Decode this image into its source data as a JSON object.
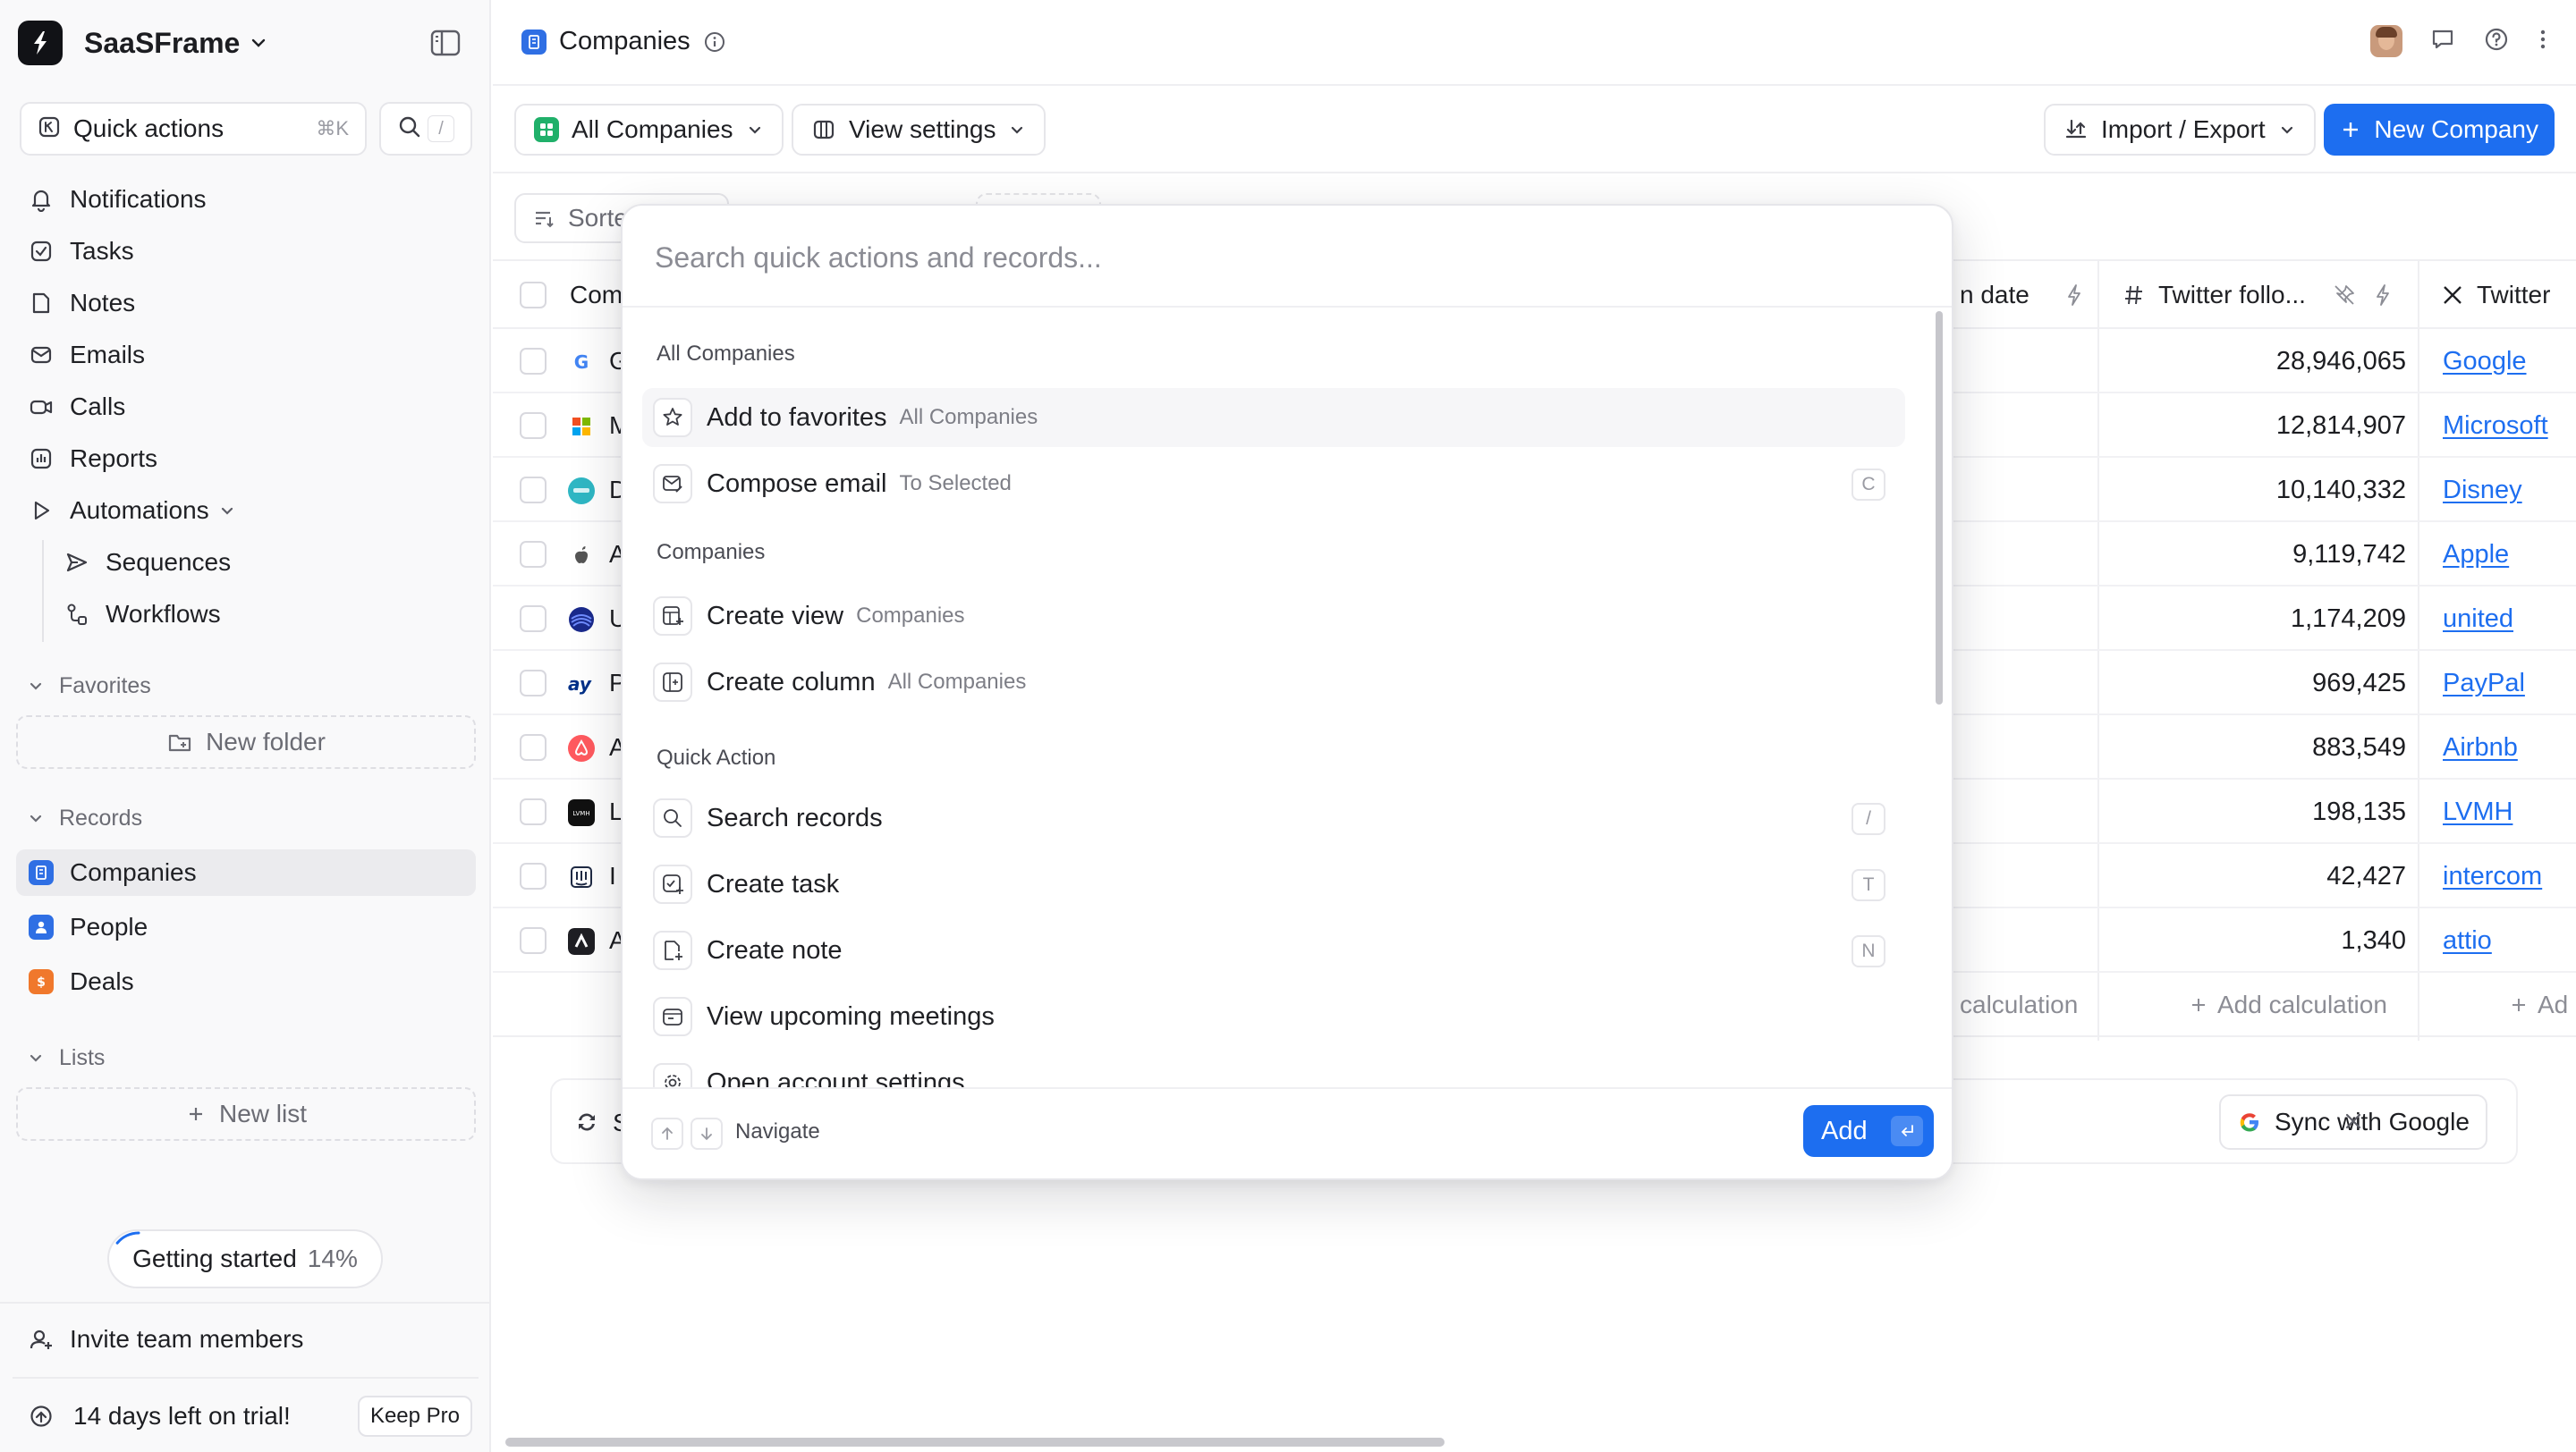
{
  "workspace": {
    "name": "SaaSFrame"
  },
  "quick_actions": {
    "label": "Quick actions",
    "shortcut": "⌘K",
    "search_shortcut": "/"
  },
  "nav": {
    "notifications": "Notifications",
    "tasks": "Tasks",
    "notes": "Notes",
    "emails": "Emails",
    "calls": "Calls",
    "reports": "Reports",
    "automations": "Automations",
    "sequences": "Sequences",
    "workflows": "Workflows"
  },
  "favorites": {
    "title": "Favorites",
    "new_folder": "New folder"
  },
  "records": {
    "title": "Records",
    "companies": "Companies",
    "people": "People",
    "deals": "Deals"
  },
  "lists": {
    "title": "Lists",
    "new_list": "New list"
  },
  "getting_started": {
    "label": "Getting started",
    "percent": "14%",
    "progress": 0.14
  },
  "invite": "Invite team members",
  "trial": {
    "text": "14 days left on trial!",
    "cta": "Keep Pro"
  },
  "header": {
    "title": "Companies"
  },
  "toolbar": {
    "view": "All Companies",
    "view_settings": "View settings",
    "import_export": "Import / Export",
    "new_company": "New Company",
    "sort": "Sorte"
  },
  "table": {
    "columns": {
      "company": "Com",
      "date": "n date",
      "twitter_followers": "Twitter follo...",
      "twitter": "Twitter"
    },
    "rows": [
      {
        "name": "G",
        "followers": "28,946,065",
        "twitter": "Google"
      },
      {
        "name": "M",
        "followers": "12,814,907",
        "twitter": "Microsoft"
      },
      {
        "name": "D",
        "followers": "10,140,332",
        "twitter": "Disney"
      },
      {
        "name": "A",
        "followers": "9,119,742",
        "twitter": "Apple"
      },
      {
        "name": "U",
        "followers": "1,174,209",
        "twitter": "united"
      },
      {
        "name": "P",
        "followers": "969,425",
        "twitter": "PayPal"
      },
      {
        "name": "A",
        "followers": "883,549",
        "twitter": "Airbnb"
      },
      {
        "name": "L",
        "followers": "198,135",
        "twitter": "LVMH"
      },
      {
        "name": "I",
        "followers": "42,427",
        "twitter": "intercom"
      },
      {
        "name": "A",
        "followers": "1,340",
        "twitter": "attio"
      }
    ],
    "calc_partial": "calculation",
    "calc_full": "Add calculation",
    "calc_cut": "Ad"
  },
  "banner": {
    "left_text": "S",
    "sync": "Sync with Google"
  },
  "palette": {
    "placeholder": "Search quick actions and records...",
    "groups": [
      "All Companies",
      "Companies",
      "Quick Action"
    ],
    "items": [
      {
        "label": "Add to favorites",
        "context": "All Companies",
        "key": ""
      },
      {
        "label": "Compose email",
        "context": "To Selected",
        "key": "C"
      },
      {
        "label": "Create view",
        "context": "Companies",
        "key": ""
      },
      {
        "label": "Create column",
        "context": "All Companies",
        "key": ""
      },
      {
        "label": "Search records",
        "context": "",
        "key": "/"
      },
      {
        "label": "Create task",
        "context": "",
        "key": "T"
      },
      {
        "label": "Create note",
        "context": "",
        "key": "N"
      },
      {
        "label": "View upcoming meetings",
        "context": "",
        "key": ""
      },
      {
        "label": "Open account settings",
        "context": "",
        "key": ""
      }
    ],
    "footer": {
      "navigate": "Navigate",
      "add": "Add"
    }
  },
  "colors": {
    "accent": "#1d6ef0",
    "sidebar_bg": "#f9f9fa"
  }
}
